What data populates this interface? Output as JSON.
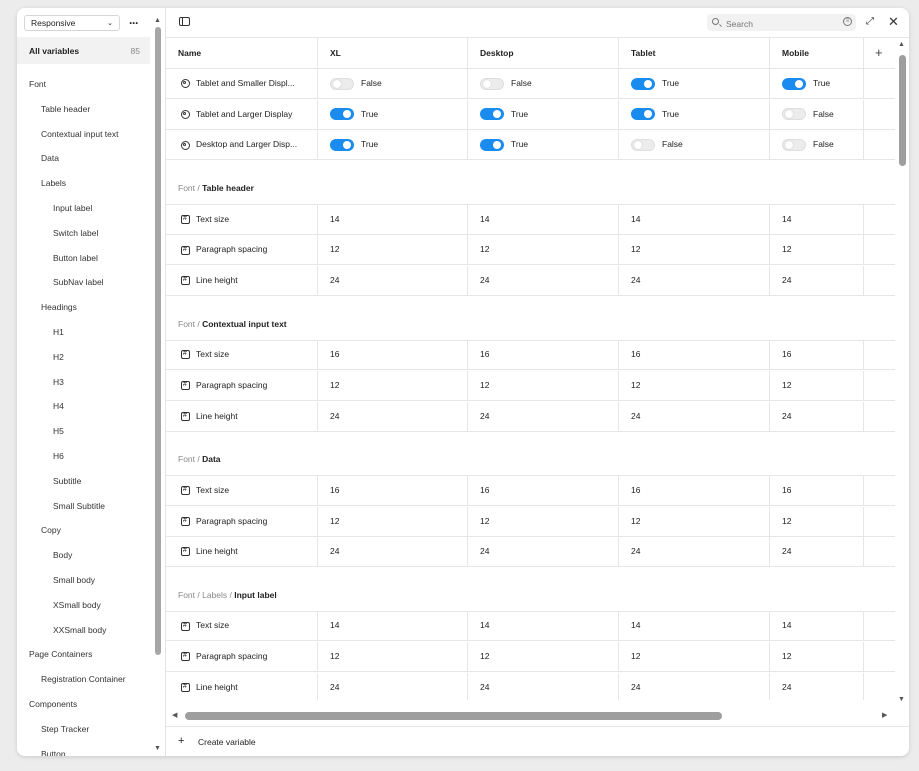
{
  "sidebar": {
    "mode": "Responsive",
    "all_variables": {
      "label": "All variables",
      "count": "85"
    },
    "items": [
      {
        "label": "Font",
        "level": 0
      },
      {
        "label": "Table header",
        "level": 1
      },
      {
        "label": "Contextual input text",
        "level": 1
      },
      {
        "label": "Data",
        "level": 1
      },
      {
        "label": "Labels",
        "level": 1
      },
      {
        "label": "Input label",
        "level": 2
      },
      {
        "label": "Switch label",
        "level": 2
      },
      {
        "label": "Button label",
        "level": 2
      },
      {
        "label": "SubNav label",
        "level": 2
      },
      {
        "label": "Headings",
        "level": 1
      },
      {
        "label": "H1",
        "level": 2
      },
      {
        "label": "H2",
        "level": 2
      },
      {
        "label": "H3",
        "level": 2
      },
      {
        "label": "H4",
        "level": 2
      },
      {
        "label": "H5",
        "level": 2
      },
      {
        "label": "H6",
        "level": 2
      },
      {
        "label": "Subtitle",
        "level": 2
      },
      {
        "label": "Small Subtitle",
        "level": 2
      },
      {
        "label": "Copy",
        "level": 1
      },
      {
        "label": "Body",
        "level": 2
      },
      {
        "label": "Small body",
        "level": 2
      },
      {
        "label": "XSmall body",
        "level": 2
      },
      {
        "label": "XXSmall body",
        "level": 2
      },
      {
        "label": "Page Containers",
        "level": 0
      },
      {
        "label": "Registration Container",
        "level": 1
      },
      {
        "label": "Components",
        "level": 0
      },
      {
        "label": "Step Tracker",
        "level": 1
      },
      {
        "label": "Button",
        "level": 1
      }
    ]
  },
  "search": {
    "placeholder": "Search"
  },
  "table": {
    "columns": [
      "Name",
      "XL",
      "Desktop",
      "Tablet",
      "Mobile"
    ],
    "bool_rows": [
      {
        "name": "Tablet and Smaller Displ...",
        "values": [
          {
            "on": false,
            "label": "False"
          },
          {
            "on": false,
            "label": "False"
          },
          {
            "on": true,
            "label": "True"
          },
          {
            "on": true,
            "label": "True"
          }
        ]
      },
      {
        "name": "Tablet and Larger Display",
        "values": [
          {
            "on": true,
            "label": "True"
          },
          {
            "on": true,
            "label": "True"
          },
          {
            "on": true,
            "label": "True"
          },
          {
            "on": false,
            "label": "False"
          }
        ]
      },
      {
        "name": "Desktop and Larger Disp...",
        "values": [
          {
            "on": true,
            "label": "True"
          },
          {
            "on": true,
            "label": "True"
          },
          {
            "on": false,
            "label": "False"
          },
          {
            "on": false,
            "label": "False"
          }
        ]
      }
    ],
    "groups": [
      {
        "path": "Font / ",
        "name": "Table header",
        "rows": [
          {
            "name": "Text size",
            "values": [
              "14",
              "14",
              "14",
              "14"
            ]
          },
          {
            "name": "Paragraph spacing",
            "values": [
              "12",
              "12",
              "12",
              "12"
            ]
          },
          {
            "name": "Line height",
            "values": [
              "24",
              "24",
              "24",
              "24"
            ]
          }
        ]
      },
      {
        "path": "Font / ",
        "name": "Contextual input text",
        "rows": [
          {
            "name": "Text size",
            "values": [
              "16",
              "16",
              "16",
              "16"
            ]
          },
          {
            "name": "Paragraph spacing",
            "values": [
              "12",
              "12",
              "12",
              "12"
            ]
          },
          {
            "name": "Line height",
            "values": [
              "24",
              "24",
              "24",
              "24"
            ]
          }
        ]
      },
      {
        "path": "Font / ",
        "name": "Data",
        "rows": [
          {
            "name": "Text size",
            "values": [
              "16",
              "16",
              "16",
              "16"
            ]
          },
          {
            "name": "Paragraph spacing",
            "values": [
              "12",
              "12",
              "12",
              "12"
            ]
          },
          {
            "name": "Line height",
            "values": [
              "24",
              "24",
              "24",
              "24"
            ]
          }
        ]
      },
      {
        "path": "Font / Labels / ",
        "name": "Input label",
        "rows": [
          {
            "name": "Text size",
            "values": [
              "14",
              "14",
              "14",
              "14"
            ]
          },
          {
            "name": "Paragraph spacing",
            "values": [
              "12",
              "12",
              "12",
              "12"
            ]
          },
          {
            "name": "Line height",
            "values": [
              "24",
              "24",
              "24",
              "24"
            ]
          }
        ]
      }
    ]
  },
  "footer": {
    "create_label": "Create variable"
  },
  "colors": {
    "toggle_on": "#1a8cf0",
    "selected_bg": "#f2f2f2"
  }
}
